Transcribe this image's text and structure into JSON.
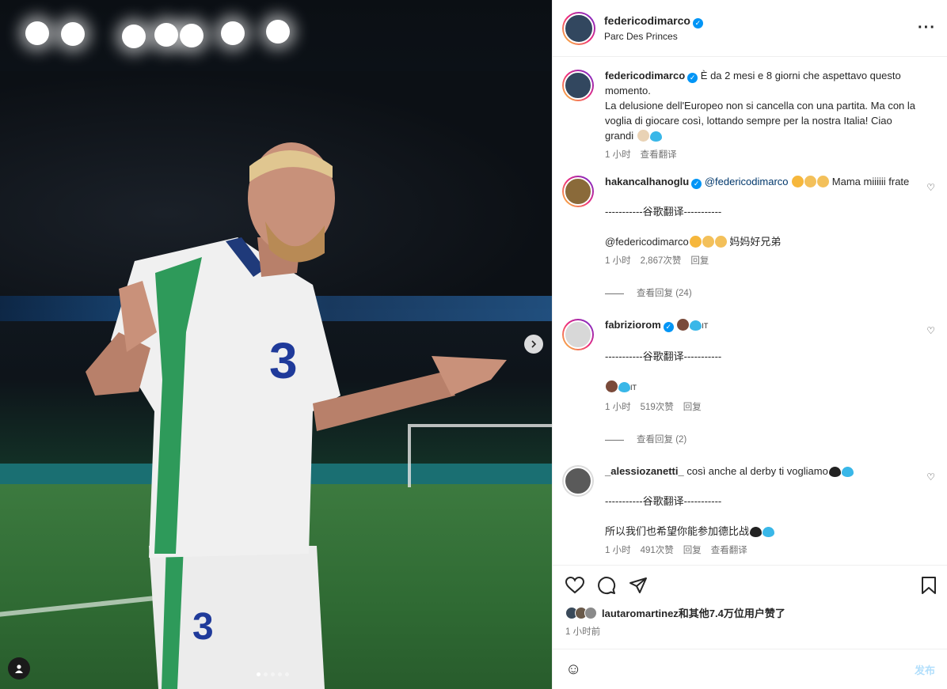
{
  "post": {
    "username": "federicodimarco",
    "location": "Parc Des Princes",
    "more_icon": "more-horizontal-icon"
  },
  "caption": {
    "username": "federicodimarco",
    "text": "È da 2 mesi e 8 giorni che aspettavo questo momento.\nLa delusione dell'Europeo non si cancella con una partita. Ma con la voglia di giocare così, lottando sempre per la nostra Italia! Ciao grandi",
    "time": "1 小时",
    "translate": "查看翻译"
  },
  "comments": [
    {
      "username": "hakancalhanoglu",
      "mention": "@federicodimarco",
      "text": "Mama miiiiii frate",
      "divider": "-----------谷歌翻译-----------",
      "translation_mention": "@federicodimarco",
      "translation": "妈妈好兄弟",
      "time": "1 小时",
      "likes": "2,867次赞",
      "reply": "回复",
      "view_replies": "查看回复 (24)"
    },
    {
      "username": "fabriziorom",
      "text": "IT",
      "divider": "-----------谷歌翻译-----------",
      "translation": "IT",
      "time": "1 小时",
      "likes": "519次赞",
      "reply": "回复",
      "view_replies": "查看回复 (2)"
    },
    {
      "username": "_alessiozanetti_",
      "text": "così anche al derby ti vogliamo",
      "divider": "-----------谷歌翻译-----------",
      "translation": "所以我们也希望你能参加德比战",
      "time": "1 小时",
      "likes": "491次赞",
      "reply": "回复",
      "translate": "查看翻译"
    }
  ],
  "actions": {
    "liked_by": "lautaromartinez和其他7.4万位用户赞了",
    "time_ago": "1 小时前"
  },
  "add_comment": {
    "placeholder": "",
    "post_label": "发布"
  },
  "colors": {
    "accent": "#0095f6",
    "mention": "#00376b",
    "muted": "#737373"
  }
}
